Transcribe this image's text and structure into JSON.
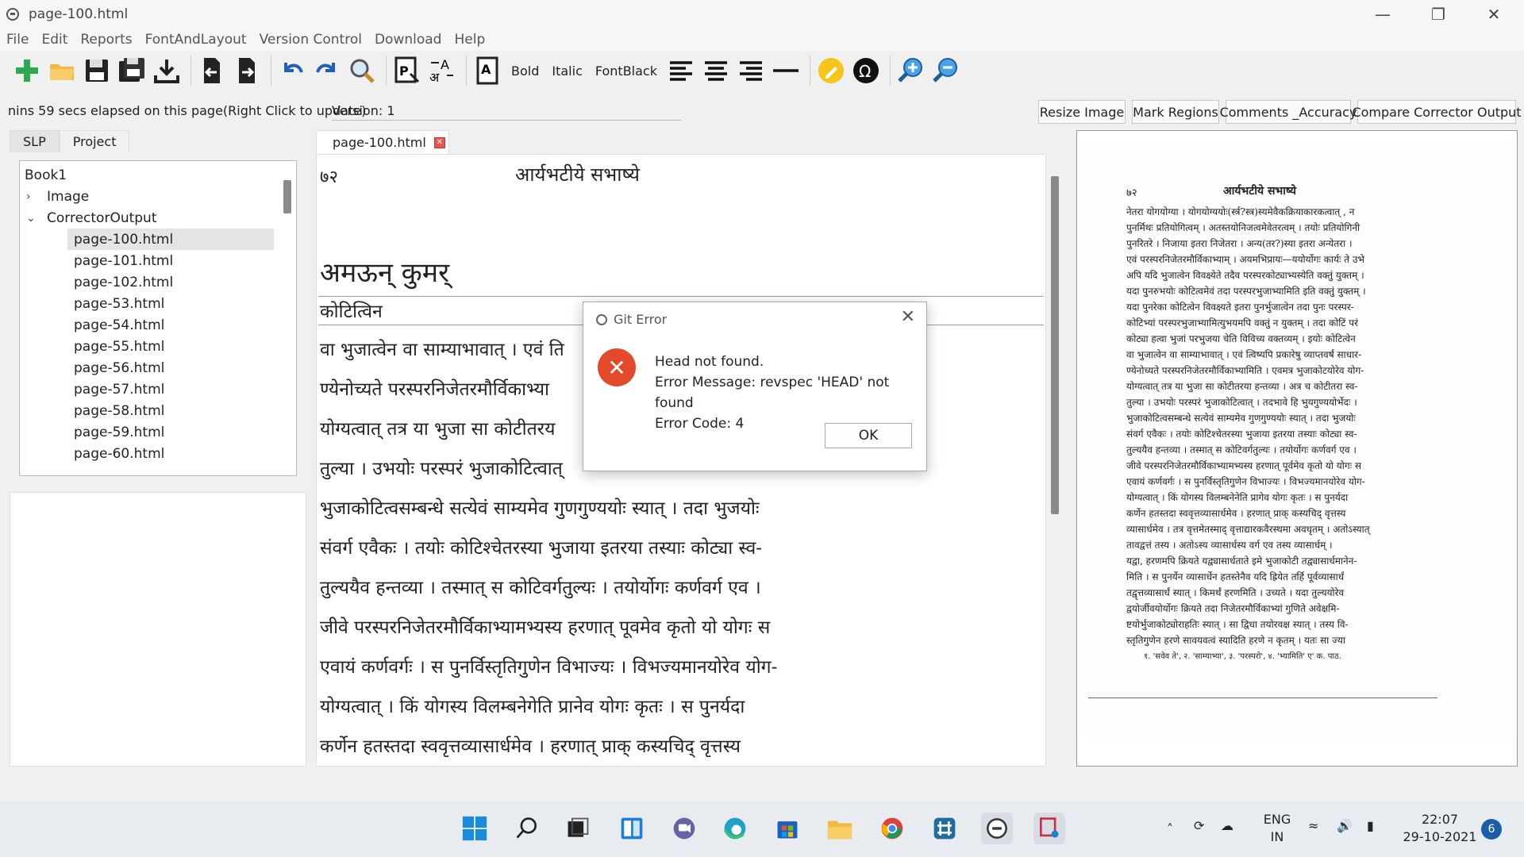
{
  "window": {
    "title": "page-100.html"
  },
  "menu": [
    "File",
    "Edit",
    "Reports",
    "FontAndLayout",
    "Version Control",
    "Download",
    "Help"
  ],
  "toolbar": {
    "bold": "Bold",
    "italic": "Italic",
    "fontblack": "FontBlack"
  },
  "status": {
    "elapsed": "nins 59 secs elapsed on this page(Right Click to update)",
    "version": "Version: 1"
  },
  "top_buttons": [
    "Resize Image",
    "Mark Regions",
    "Comments _Accuracy",
    "Compare Corrector Output"
  ],
  "left_tabs": [
    "SLP",
    "Project"
  ],
  "tree": {
    "root": "Book1",
    "folders": [
      "Image",
      "CorrectorOutput"
    ],
    "files": [
      "page-100.html",
      "page-101.html",
      "page-102.html",
      "page-53.html",
      "page-54.html",
      "page-55.html",
      "page-56.html",
      "page-57.html",
      "page-58.html",
      "page-59.html",
      "page-60.html"
    ]
  },
  "editor": {
    "tab": "page-100.html",
    "page_number": "७२",
    "title": "आर्यभटीये सभाष्ये",
    "heading": "अमऊन् कुमर्",
    "subheading": "कोटित्विन",
    "lines": [
      "वा भुजात्वेन वा साम्याभावात् । एवं ति",
      "ण्येनोच्यते परस्परनिजेतरमौर्विकाभ्या",
      "योग्यत्वात् तत्र या भुजा सा कोटीतरय",
      "तुल्या । उभयोः परस्परं भुजाकोटित्वात्",
      "भुजाकोटित्वसम्बन्धे सत्येवं साम्यमेव गुणगुण्ययोः स्यात् । तदा भुजयोः",
      "संवर्ग एवैकः । तयोः कोटिश्चेतरस्या भुजाया इतरया तस्याः कोट्या स्व-",
      "तुल्ययैव हन्तव्या । तस्मात् स कोटिवर्गतुल्यः । तयोर्योगः कर्णवर्ग एव ।",
      "जीवे परस्परनिजेतरमौर्विकाभ्यामभ्यस्य हरणात् पूवमेव कृतो यो योगः स",
      "एवायं कर्णवर्गः । स पुनर्विस्तृतिगुणेन विभाज्यः । विभज्यमानयोरेव योग-",
      "योग्यत्वात् । किं योगस्य विलम्बनेगेति प्रानेव योगः कृतः । स पुनर्यदा",
      "कर्णेन हतस्तदा स्ववृत्तव्यासार्धमेव । हरणात् प्राक् कस्यचिद् वृत्तस्य"
    ]
  },
  "scan": {
    "page_number": "७२",
    "title": "आर्यभटीये सभाष्ये",
    "lines": [
      "नेतरा योगयोग्या । योगयोग्ययोः(र्स्त्र?स्त्र)स्यमेवैकक्रियाकारकत्वात् , न",
      "पुनर्मिथः प्रतियोगित्वम् । अतस्तयोनिजत्वमेवेतरत्वम् । तयोः प्रतियोगिनी",
      "पुनरितरे । निजाया इतरा निजेतरा । अन्य(तर?)स्या इतरा अन्येतरा ।",
      "एवं परस्परनिजेतरमौर्विकाभ्याम् । अयमभिप्रायः—ययोर्योगः कार्यः ते उभे",
      "अपि यदि भुजात्वेन विवक्ष्येते तदैव परस्परकोट्याभ्यस्येति वक्तुं युक्तम् ।",
      "यदा पुनरुभयोः कोटित्वमेवं तदा परस्परभुजाभ्यामिति इति वक्तुं युक्तम् ।",
      "यदा पुनरेका कोटित्वेन विवक्ष्यते इतरा पुनर्भुजात्वेन तदा पुनः परस्पर-",
      "कोटिभ्यां परस्परभुजाभ्यामित्युभयमपि वक्तुं न युक्तम् । तदा कोटिं परं",
      "कोट्या हत्वा भुजां परभुजया चेति विविच्य वक्तव्यम् । इयोः कोटित्वेन",
      "वा भुजात्वेन वा साम्याभावात् । एवं त्विष्यपि प्रकारेषु व्याप्तवर्षं साधार-",
      "ण्येनोच्यते परस्परनिजेतरमौर्विकाभ्यामिति । एवमत्र भुजाकोटयोरेव योग-",
      "योग्यत्वात् तत्र या भुजा सा कोटीतरया हन्तव्या । अत्र च कोटीतरा स्व-",
      "तुल्या । उभयोः परस्परं भुजाकोटित्वात् । तदभावे हि भुयगुण्ययोर्भेदः ।",
      "भुजाकोटित्वसम्बन्धे सत्येवं साम्यमेव गुणगुण्ययोः स्यात् । तदा भुजयोः",
      "संवर्ग एवैकः । तयोः कोटिश्चेतरस्या भुजाया इतरया तस्याः कोट्या स्व-",
      "तुल्ययैव हन्तव्या । तस्मात् स कोटिवर्गतुल्यः । तयोर्योगः कर्णवर्ग एव ।",
      "जीवे परस्परनिजेतरमौर्विकाभ्यामभ्यस्य हरणात् पूर्वमेव कृतो यो योगः स",
      "एवायं कर्णवर्गः । स पुनर्विस्तृतिगुणेन विभाज्यः । विभज्यमानयोरेव योग-",
      "योग्यत्वात् । किं योगस्य विलम्बनेनेति प्रागेव योगः कृतः । स पुनर्यदा",
      "कर्णेन हतस्तदा स्ववृत्तव्यासार्धमेव । हरणात् प्राक् कस्यचिद् वृत्तस्य",
      "व्यासार्धमेव । तत्र वृत्तमेतस्माद् वृत्ताद्यारकवैरस्थमा अवधृतम् । अतोऽस्यात्",
      "तावद्वत्तं तस्य । अतोऽस्य व्यासार्धस्य वर्ग एव तस्य व्यासार्धम् ।",
      "यद्वा, हरणमपि क्रियते यद्व्यासार्धताते इमे भुजाकोटी तद्व्यासार्धमानेन-",
      "मिति । स पुनर्येन व्यासार्धेन हतस्तेनैव यदि ह्रियेत तर्हि पूर्वव्यासार्धं",
      "तद्वृत्तव्यासार्धं स्यात् । किमर्थं हरणमिति । उच्यते । यदा तुल्ययोरेव",
      "द्वयोर्जीवयोर्योगः क्रियते तदा निजेतरमौर्विकाभ्यां गुणिते अवेक्षमि-",
      "ष्टयोर्भुजाकोट्योराहतिः स्यात् । सा द्विधा तयोरवक्ष स्यात् । तस्य वि-",
      "स्तृतिगुणेन हरणे सावयवत्वं स्यादिति हरणे न कृतम् । यतः सा ज्या"
    ],
    "footnote": "१. 'सवेव ते', २. 'साम्याभ्या', ३. 'परस्परो', ४. 'भ्यामिति' ए' क. पाठ."
  },
  "dialog": {
    "title": "Git Error",
    "line1": "Head not found.",
    "line2": "Error Message: revspec 'HEAD' not found",
    "line3": "Error Code: 4",
    "ok": "OK"
  },
  "tray": {
    "lang1": "ENG",
    "lang2": "IN",
    "time": "22:07",
    "date": "29-10-2021",
    "notifications": "6"
  },
  "colors": {
    "accent": "#1b5fa8",
    "error": "#e24a2a"
  }
}
